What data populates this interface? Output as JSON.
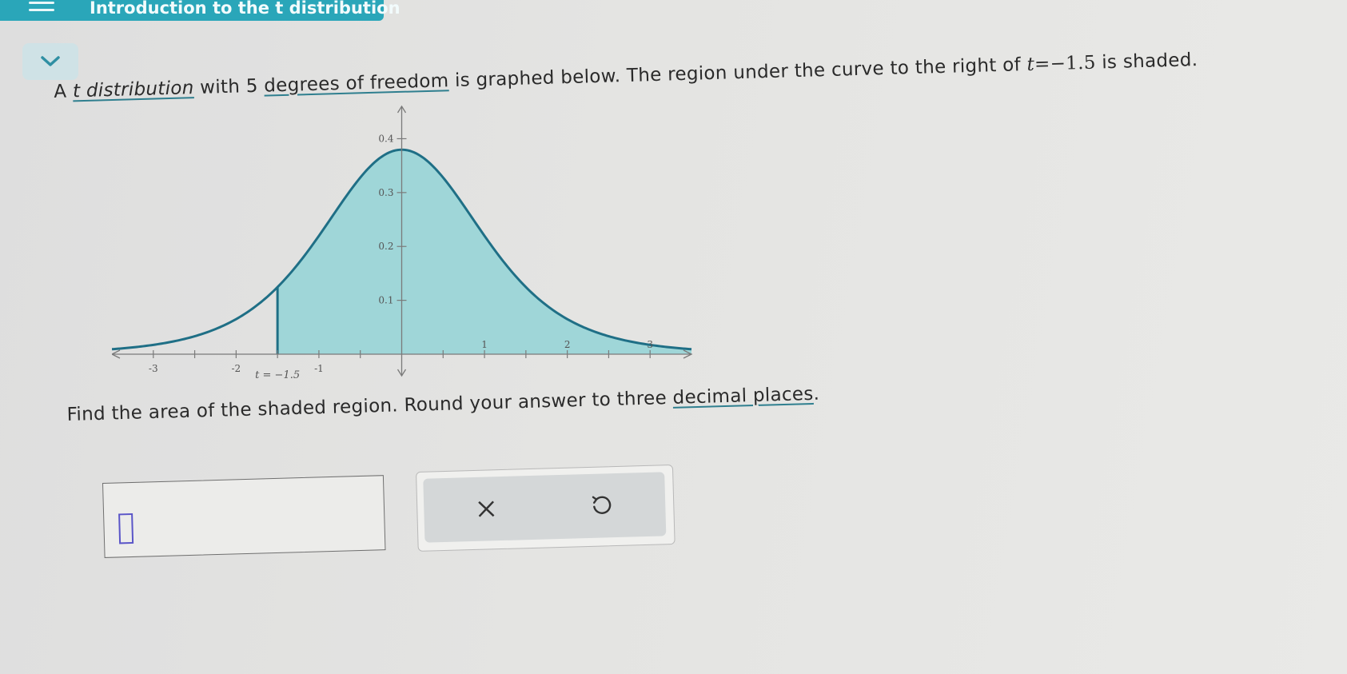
{
  "header": {
    "title": "Introduction to the t distribution",
    "menu_icon": "hamburger-menu-icon",
    "accent_color": "#2aa6b9"
  },
  "collapse_icon": "chevron-down-icon",
  "question": {
    "part1": "A ",
    "t_link": "t distribution",
    "part2": " with 5 ",
    "dof_link": "degrees of freedom",
    "part3": " is graphed below. The region under the curve to the right of ",
    "math_t": "t",
    "math_eq": "=−1.5",
    "part4": " is shaded."
  },
  "chart_data": {
    "type": "area",
    "distribution": "t",
    "degrees_of_freedom": 5,
    "shaded_from": -1.5,
    "xlim": [
      -3.5,
      3.5
    ],
    "ylim": [
      0,
      0.42
    ],
    "x_ticks": [
      "-3",
      "-2",
      "-1",
      "1",
      "2",
      "3"
    ],
    "y_ticks": [
      "0.1",
      "0.2",
      "0.3",
      "0.4"
    ],
    "marker_label": "t = −1.5",
    "fill_color": "#9fd6d8",
    "curve_color": "#1f6f86"
  },
  "prompt": {
    "part1": "Find the area of the shaded region. Round your answer to three ",
    "link": "decimal places",
    "part2": "."
  },
  "answer": {
    "value": ""
  },
  "buttons": {
    "clear_icon": "close-icon",
    "undo_icon": "undo-icon"
  }
}
